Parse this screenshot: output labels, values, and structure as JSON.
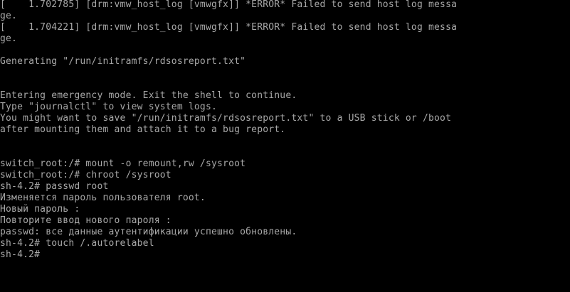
{
  "terminal": {
    "lines": [
      "[    1.702785] [drm:vmw_host_log [vmwgfx]] *ERROR* Failed to send host log messa",
      "ge.",
      "[    1.704221] [drm:vmw_host_log [vmwgfx]] *ERROR* Failed to send host log messa",
      "ge.",
      "",
      "Generating \"/run/initramfs/rdsosreport.txt\"",
      "",
      "",
      "Entering emergency mode. Exit the shell to continue.",
      "Type \"journalctl\" to view system logs.",
      "You might want to save \"/run/initramfs/rdsosreport.txt\" to a USB stick or /boot",
      "after mounting them and attach it to a bug report.",
      "",
      "",
      "switch_root:/# mount -o remount,rw /sysroot",
      "switch_root:/# chroot /sysroot",
      "sh-4.2# passwd root",
      "Изменяется пароль пользователя root.",
      "Новый пароль :",
      "Повторите ввод нового пароля :",
      "passwd: все данные аутентификации успешно обновлены.",
      "sh-4.2# touch /.autorelabel",
      "sh-4.2#"
    ],
    "colors": {
      "background": "#000000",
      "text": "#a8a8a8"
    }
  }
}
